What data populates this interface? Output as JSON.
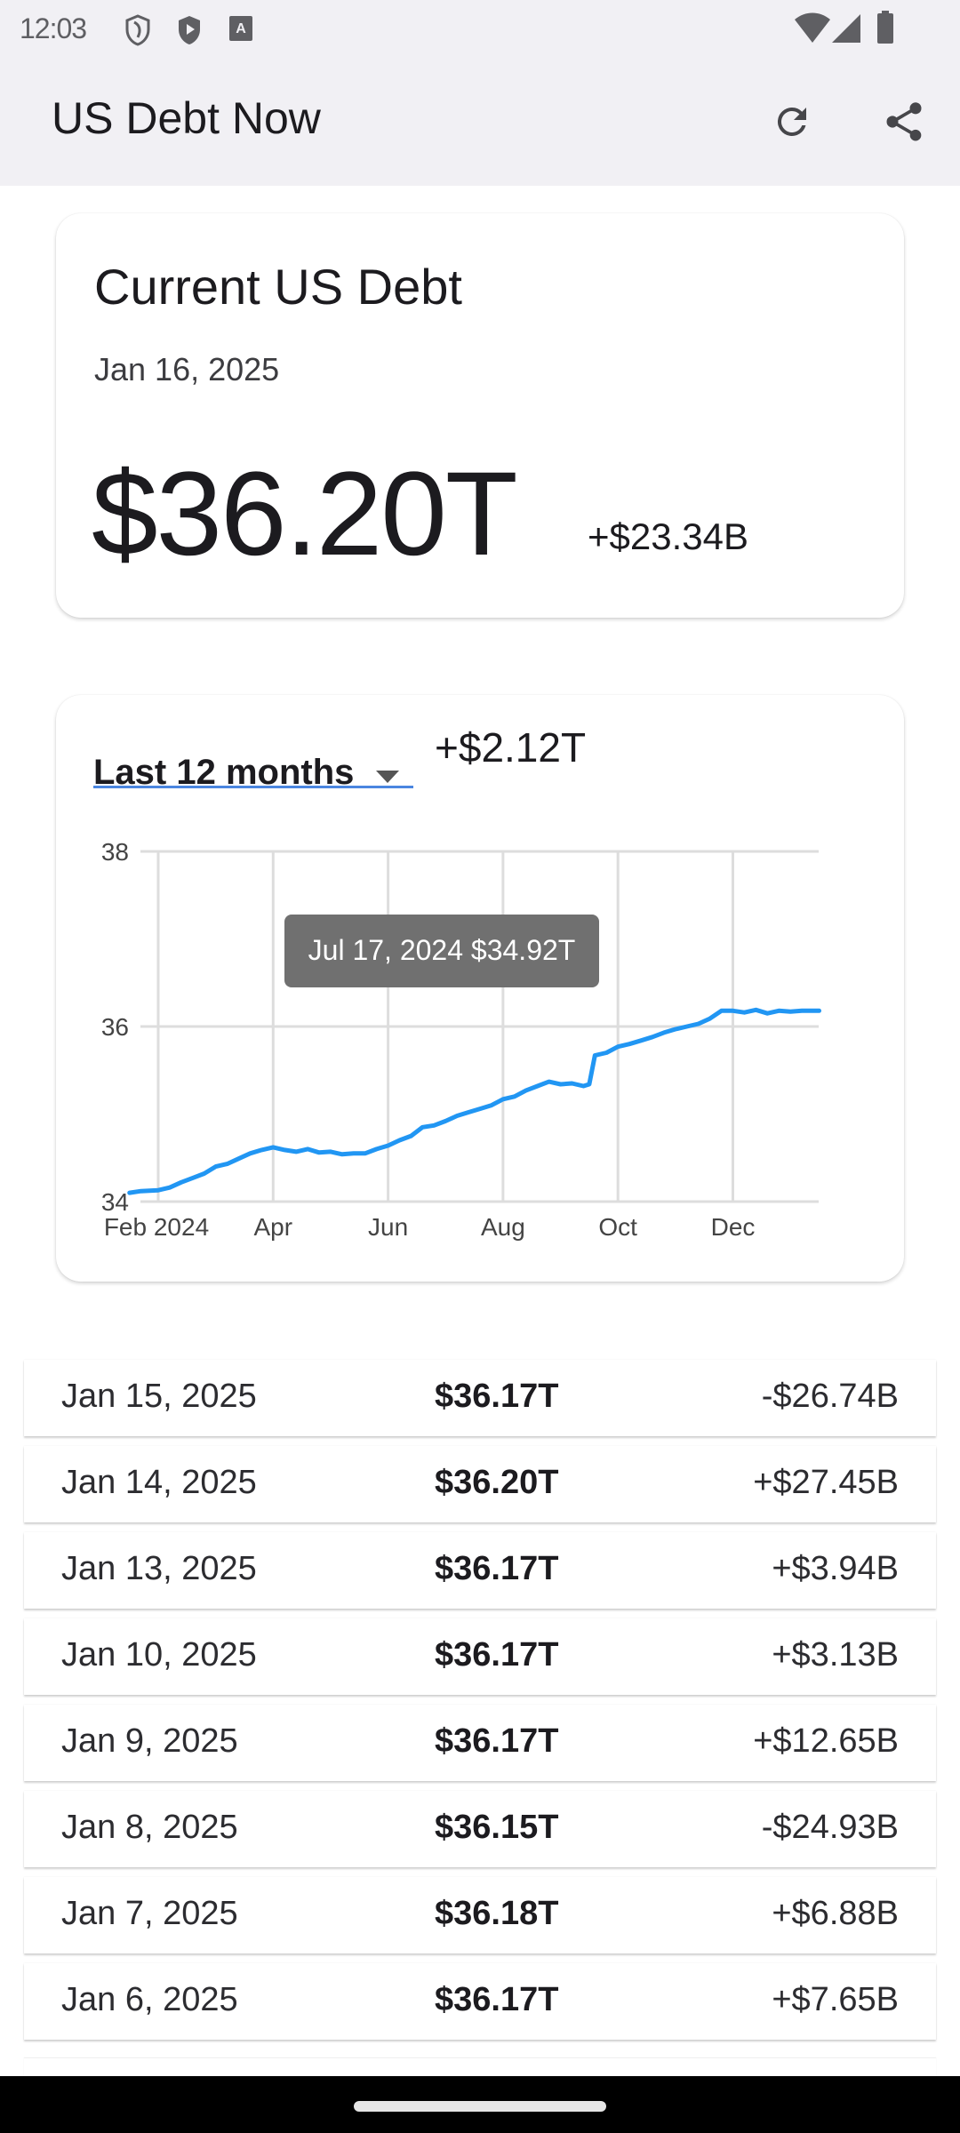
{
  "status_bar": {
    "time": "12:03",
    "left_icons": [
      "shield-outline-icon",
      "play-shield-icon",
      "a-keyboard-icon"
    ],
    "right_icons": [
      "wifi-icon",
      "signal-icon",
      "battery-icon"
    ]
  },
  "app_bar": {
    "title": "US Debt Now",
    "actions": [
      "refresh-icon",
      "share-icon"
    ]
  },
  "current": {
    "title": "Current US Debt",
    "date": "Jan 16, 2025",
    "value": "$36.20T",
    "change": "+$23.34B"
  },
  "chart_card": {
    "range_label": "Last 12 months",
    "range_change": "+$2.12T",
    "tooltip": "Jul 17, 2024 $34.92T",
    "line_color": "#2196f3",
    "accent_color": "#4a86e0"
  },
  "chart_data": {
    "type": "line",
    "title": "",
    "xlabel": "",
    "ylabel": "",
    "ylim": [
      34,
      38
    ],
    "yticks": [
      "38",
      "36",
      "34"
    ],
    "xticks": [
      "Feb 2024",
      "Apr",
      "Jun",
      "Aug",
      "Oct",
      "Dec"
    ],
    "grid": true,
    "units": "Trillions USD",
    "series": [
      {
        "name": "US Debt",
        "x_months_since_feb_2024": [
          -0.5,
          -0.3,
          0.0,
          0.2,
          0.4,
          0.6,
          0.8,
          1.0,
          1.2,
          1.4,
          1.6,
          1.8,
          2.0,
          2.2,
          2.4,
          2.6,
          2.8,
          3.0,
          3.2,
          3.4,
          3.6,
          3.8,
          4.0,
          4.2,
          4.4,
          4.6,
          4.8,
          5.0,
          5.2,
          5.4,
          5.6,
          5.8,
          6.0,
          6.2,
          6.4,
          6.6,
          6.8,
          7.0,
          7.2,
          7.4,
          7.5,
          7.6,
          7.8,
          8.0,
          8.2,
          8.4,
          8.6,
          8.8,
          9.0,
          9.2,
          9.4,
          9.6,
          9.8,
          10.0,
          10.2,
          10.4,
          10.6,
          10.8,
          11.0,
          11.2,
          11.5
        ],
        "values": [
          34.1,
          34.12,
          34.13,
          34.16,
          34.22,
          34.27,
          34.32,
          34.4,
          34.43,
          34.49,
          34.55,
          34.59,
          34.62,
          34.59,
          34.57,
          34.6,
          34.56,
          34.57,
          34.54,
          34.55,
          34.55,
          34.6,
          34.64,
          34.7,
          34.75,
          34.85,
          34.87,
          34.92,
          34.98,
          35.02,
          35.06,
          35.1,
          35.17,
          35.2,
          35.27,
          35.32,
          35.37,
          35.34,
          35.35,
          35.32,
          35.34,
          35.67,
          35.7,
          35.77,
          35.8,
          35.84,
          35.88,
          35.93,
          35.97,
          36.0,
          36.03,
          36.09,
          36.18,
          36.18,
          36.16,
          36.19,
          36.15,
          36.18,
          36.17,
          36.18,
          36.18
        ]
      }
    ],
    "tooltip": {
      "date": "Jul 17, 2024",
      "value": 34.92
    }
  },
  "history": [
    {
      "date": "Jan 15, 2025",
      "value": "$36.17T",
      "change": "-$26.74B"
    },
    {
      "date": "Jan 14, 2025",
      "value": "$36.20T",
      "change": "+$27.45B"
    },
    {
      "date": "Jan 13, 2025",
      "value": "$36.17T",
      "change": "+$3.94B"
    },
    {
      "date": "Jan 10, 2025",
      "value": "$36.17T",
      "change": "+$3.13B"
    },
    {
      "date": "Jan 9, 2025",
      "value": "$36.17T",
      "change": "+$12.65B"
    },
    {
      "date": "Jan 8, 2025",
      "value": "$36.15T",
      "change": "-$24.93B"
    },
    {
      "date": "Jan 7, 2025",
      "value": "$36.18T",
      "change": "+$6.88B"
    },
    {
      "date": "Jan 6, 2025",
      "value": "$36.17T",
      "change": "+$7.65B"
    }
  ]
}
